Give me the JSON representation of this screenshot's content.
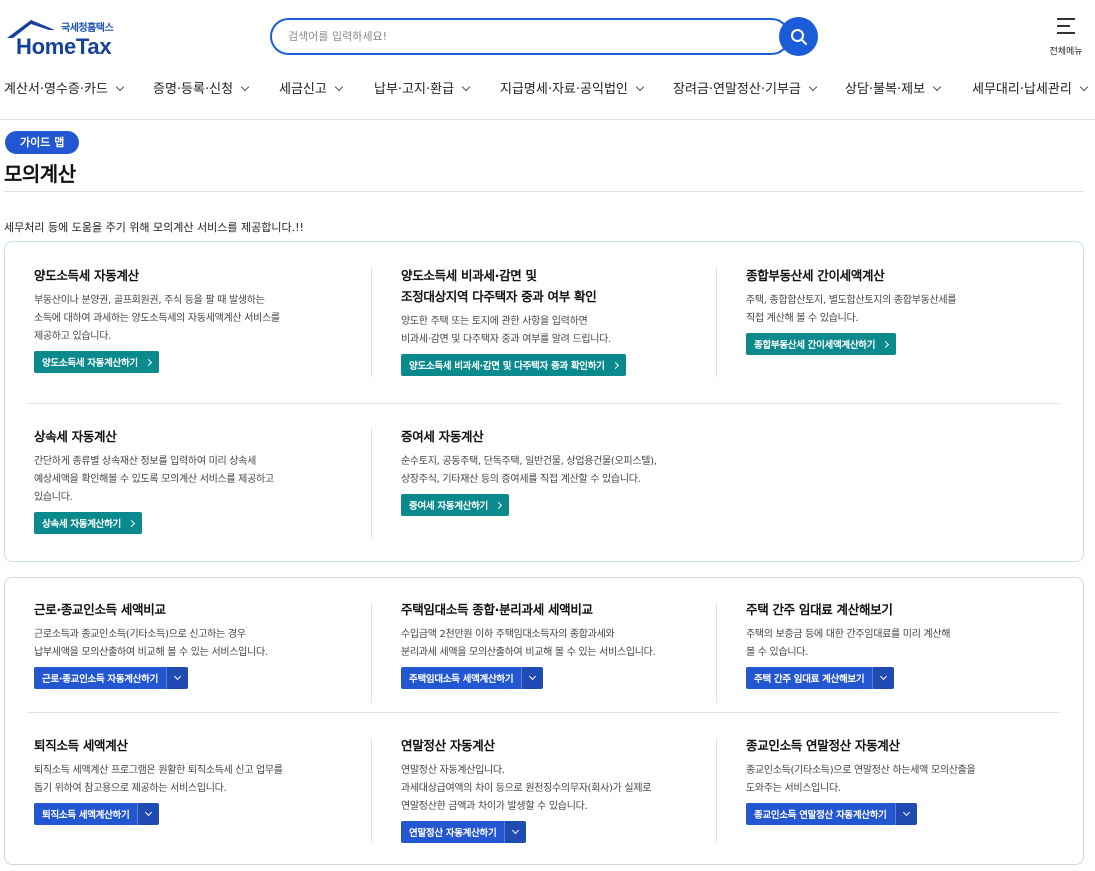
{
  "header": {
    "logo_sub": "국세청홈택스",
    "logo_main": "HomeTax",
    "search_placeholder": "검색어를 입력하세요!",
    "menu_all_label": "전체메뉴"
  },
  "gnb": [
    {
      "label": "계산서·영수증·카드"
    },
    {
      "label": "증명·등록·신청"
    },
    {
      "label": "세금신고"
    },
    {
      "label": "납부·고지·환급"
    },
    {
      "label": "지급명세·자료·공익법인"
    },
    {
      "label": "장려금·연말정산·기부금"
    },
    {
      "label": "상담·불복·제보"
    },
    {
      "label": "세무대리·납세관리"
    }
  ],
  "page": {
    "badge": "가이드 맵",
    "title": "모의계산",
    "intro": "세무처리 등에 도움을 주기 위해 모의계산 서비스를 제공합니다.!!"
  },
  "section1": [
    {
      "title": "양도소득세 자동계산",
      "desc": [
        "부동산이나 분양권, 골프회원권, 주식 등을 팔 때 발생하는",
        "소득에 대하여 과세하는 양도소득세의 자동세액계산 서비스를",
        "제공하고 있습니다."
      ],
      "button": "양도소득세 자동계산하기"
    },
    {
      "title_lines": [
        "양도소득세 비과세·감면 및",
        "조정대상지역 다주택자 중과 여부 확인"
      ],
      "desc": [
        "양도한 주택 또는 토지에 관한 사항을 입력하면",
        "비과세·감면 및 다주택자 중과 여부를 알려 드립니다."
      ],
      "button": "양도소득세 비과세·감면 및 다주택자 중과 확인하기"
    },
    {
      "title": "종합부동산세 간이세액계산",
      "desc": [
        "주택, 종합합산토지, 별도합산토지의 종합부동산세를",
        "직접 계산해 볼 수 있습니다."
      ],
      "button": "종합부동산세 간이세액계산하기"
    },
    {
      "title": "상속세 자동계산",
      "desc": [
        "간단하게 종류별 상속재산 정보를 입력하여 미리 상속세",
        "예상세액을 확인해볼 수 있도록 모의계산 서비스를 제공하고",
        "있습니다."
      ],
      "button": "상속세 자동계산하기"
    },
    {
      "title": "증여세 자동계산",
      "desc": [
        "순수토지, 공동주택, 단독주택, 일반건물, 상업용건물(오피스텔),",
        "상장주식, 기타재산 등의 증여세를 직접 계산할 수 있습니다."
      ],
      "button": "증여세 자동계산하기"
    }
  ],
  "section2": [
    {
      "title": "근로·종교인소득 세액비교",
      "desc": [
        "근로소득과 종교인소득(기타소득)으로 신고하는 경우",
        "납부세액을 모의산출하여 비교해 볼 수 있는 서비스입니다."
      ],
      "button": "근로·종교인소득 자동계산하기"
    },
    {
      "title": "주택임대소득 종합·분리과세 세액비교",
      "desc": [
        "수입금액 2천만원 이하 주택임대소득자의 종합과세와",
        "분리과세 세액을 모의산출하여 비교해 볼 수 있는 서비스입니다."
      ],
      "button": "주택임대소득 세액계산하기"
    },
    {
      "title": "주택 간주 임대료 계산해보기",
      "desc": [
        "주택의 보증금 등에 대한 간주임대료를 미리 계산해",
        "볼 수 있습니다."
      ],
      "button": "주택 간주 임대료 계산해보기"
    },
    {
      "title": "퇴직소득 세액계산",
      "desc": [
        "퇴직소득 세액계산 프로그램은 원활한 퇴직소득세 신고 업무를",
        "돕기 위하여 참고용으로 제공하는 서비스입니다."
      ],
      "button": "퇴직소득 세액계산하기"
    },
    {
      "title": "연말정산 자동계산",
      "desc": [
        "연말정산 자동계산입니다.",
        "과세대상급여액의 차이 등으로 원천징수의무자(회사)가 실제로",
        "연말정산한 금액과 차이가 발생할 수 있습니다."
      ],
      "button": "연말정산 자동계산하기"
    },
    {
      "title": "종교인소득 연말정산 자동계산",
      "desc": [
        "종교인소득(기타소득)으로 연말정산 하는세액 모의산출을",
        "도와주는 서비스입니다."
      ],
      "button": "종교인소득 연말정산 자동계산하기"
    }
  ]
}
